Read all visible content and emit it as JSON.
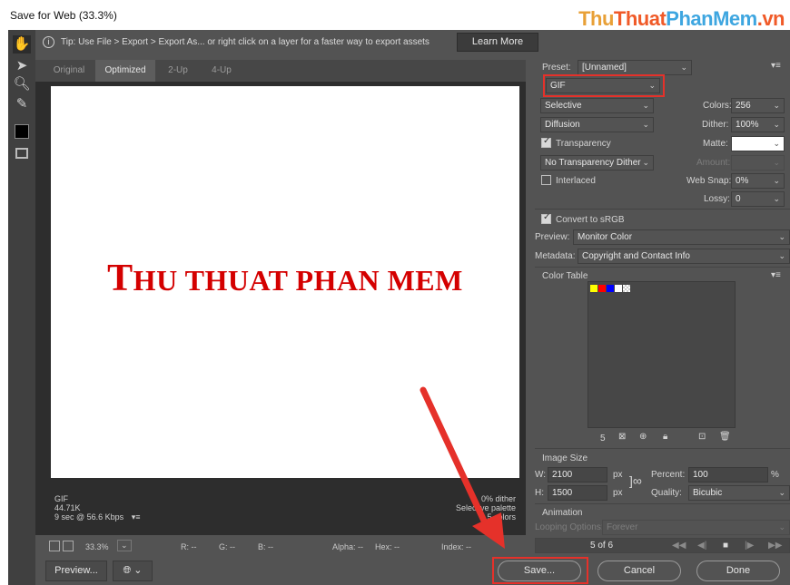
{
  "window": {
    "title": "Save for Web (33.3%)"
  },
  "watermark": {
    "part1": "Thu",
    "part2": "Thuat",
    "part3": "PhanMem",
    "part4": ".vn"
  },
  "tip": {
    "text": "Tip: Use File > Export > Export As...  or right click on a layer for a faster way to export assets",
    "learn_more": "Learn More"
  },
  "tabs": [
    {
      "label": "Original",
      "active": false
    },
    {
      "label": "Optimized",
      "active": true
    },
    {
      "label": "2-Up",
      "active": false
    },
    {
      "label": "4-Up",
      "active": false
    }
  ],
  "canvas": {
    "text_big1": "T",
    "text_rest1": "HU THUAT PHAN MEM"
  },
  "opt_info": {
    "format": "GIF",
    "size": "44.71K",
    "time": "9 sec @ 56.6 Kbps",
    "dither": "0% dither",
    "palette": "Selective palette",
    "colors": "5 colors"
  },
  "status": {
    "zoom": "33.3%",
    "r": "R: --",
    "g": "G: --",
    "b": "B: --",
    "alpha": "Alpha: --",
    "hex": "Hex: --",
    "index": "Index: --"
  },
  "buttons": {
    "preview": "Preview...",
    "save": "Save...",
    "cancel": "Cancel",
    "done": "Done"
  },
  "panel": {
    "preset_label": "Preset:",
    "preset_value": "[Unnamed]",
    "format": "GIF",
    "reduction": "Selective",
    "dither_algo": "Diffusion",
    "transparency": "Transparency",
    "transparency_dither": "No Transparency Dither",
    "interlaced": "Interlaced",
    "colors_label": "Colors:",
    "colors_value": "256",
    "dither_label": "Dither:",
    "dither_value": "100%",
    "matte_label": "Matte:",
    "amount_label": "Amount:",
    "websnap_label": "Web Snap:",
    "websnap_value": "0%",
    "lossy_label": "Lossy:",
    "lossy_value": "0",
    "convert_srgb": "Convert to sRGB",
    "preview_label": "Preview:",
    "preview_value": "Monitor Color",
    "metadata_label": "Metadata:",
    "metadata_value": "Copyright and Contact Info",
    "color_table_title": "Color Table",
    "color_count": "5",
    "image_size_title": "Image Size",
    "w_label": "W:",
    "w_value": "2100",
    "h_label": "H:",
    "h_value": "1500",
    "px": "px",
    "percent_label": "Percent:",
    "percent_value": "100",
    "percent_unit": "%",
    "quality_label": "Quality:",
    "quality_value": "Bicubic",
    "animation_title": "Animation",
    "looping_label": "Looping Options:",
    "looping_value": "Forever",
    "frame_counter": "5 of 6"
  },
  "swatch_colors": [
    "#ffff00",
    "#ff0000",
    "#0000ff",
    "#ffffff"
  ]
}
